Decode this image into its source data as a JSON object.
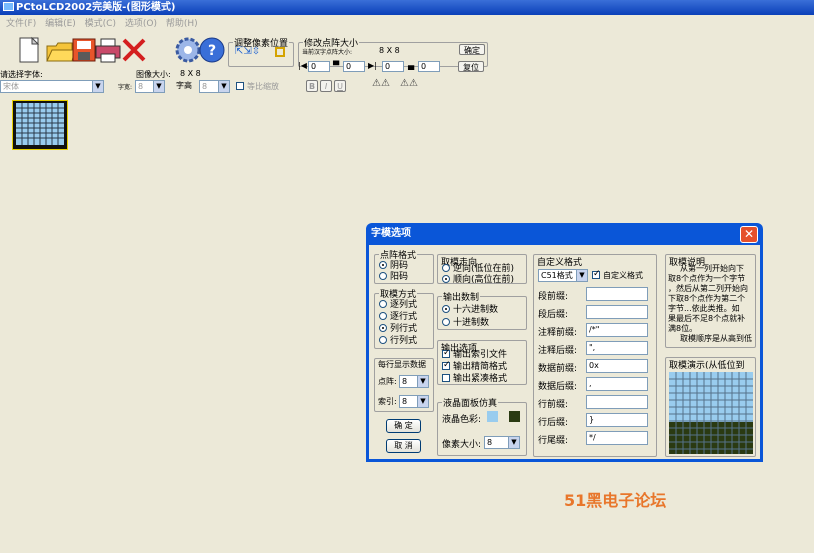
{
  "window": {
    "title": "PCtoLCD2002完美版-(图形模式)"
  },
  "menu": [
    "文件(F)",
    "编辑(E)",
    "模式(C)",
    "选项(O)",
    "帮助(H)"
  ],
  "toolbar": {
    "pixel_group_label": "调整像素位置",
    "matrix_group_label": "修改点阵大小",
    "current_size_label": "当前汉字点阵大小:",
    "current_size_value": "8 X 8",
    "confirm_label": "确定",
    "restore_label": "复位",
    "spin_values": [
      "0",
      "0",
      "0",
      "0"
    ]
  },
  "font_bar": {
    "select_font_label": "请选择字体:",
    "font_value": "宋体",
    "image_size_label": "图像大小:",
    "image_size_value": "8 X 8",
    "char_width_label": "字宽:",
    "char_width_value": "8",
    "char_height_label": "字高",
    "char_height_value": "8",
    "proportional_label": "等比缩放",
    "bold_label": "B",
    "italic_label": "I",
    "underline_label": "U"
  },
  "dialog": {
    "title": "字模选项",
    "dot_format": {
      "label": "点阵格式",
      "options": [
        "阴码",
        "阳码"
      ],
      "selected": 0
    },
    "scan_mode": {
      "label": "取模方式",
      "options": [
        "逐列式",
        "逐行式",
        "列行式",
        "行列式"
      ],
      "selected": 2
    },
    "per_line": {
      "label": "每行显示数据",
      "dots_label": "点阵:",
      "dots_value": "8",
      "index_label": "索引:",
      "index_value": "8"
    },
    "confirm_button": "确 定",
    "cancel_button": "取 消",
    "direction": {
      "label": "取模走向",
      "options": [
        "逆向(低位在前)",
        "顺向(高位在前)"
      ],
      "selected": 1
    },
    "number_system": {
      "label": "输出数制",
      "options": [
        "十六进制数",
        "十进制数"
      ],
      "selected": 0
    },
    "output_options": {
      "label": "输出选项",
      "items": [
        "输出索引文件",
        "输出精简格式",
        "输出紧凑格式"
      ],
      "checked": [
        true,
        true,
        false
      ]
    },
    "lcd_sim": {
      "label": "液晶面板仿真",
      "color_label": "液晶色彩:",
      "pixel_size_label": "像素大小:",
      "pixel_size_value": "8",
      "lcd_color": "#99ccee",
      "fg_color": "#2a3a12"
    },
    "custom_format": {
      "label": "自定义格式",
      "format_value": "C51格式",
      "custom_check_label": "自定义格式",
      "custom_checked": true,
      "fields": [
        {
          "label": "段前缀:",
          "value": ""
        },
        {
          "label": "段后缀:",
          "value": ""
        },
        {
          "label": "注释前缀:",
          "value": "/*\""
        },
        {
          "label": "注释后缀:",
          "value": "\","
        },
        {
          "label": "数据前缀:",
          "value": "0x"
        },
        {
          "label": "数据后缀:",
          "value": ","
        },
        {
          "label": "行前缀:",
          "value": ""
        },
        {
          "label": "行后缀:",
          "value": "}"
        },
        {
          "label": "行尾缀:",
          "value": "*/"
        }
      ]
    },
    "explain": {
      "label": "取模说明",
      "lines": [
        "从第一列开始向下",
        "取8个点作为一个字节",
        "，然后从第二列开始向",
        "下取8个点作为第二个",
        "字节...依此类推。如",
        "果最后不足8个点就补",
        "满8位。",
        "取模顺序是从高到低"
      ]
    },
    "demo": {
      "label": "取模演示(从低位到"
    }
  },
  "watermark": "51黑电子论坛"
}
